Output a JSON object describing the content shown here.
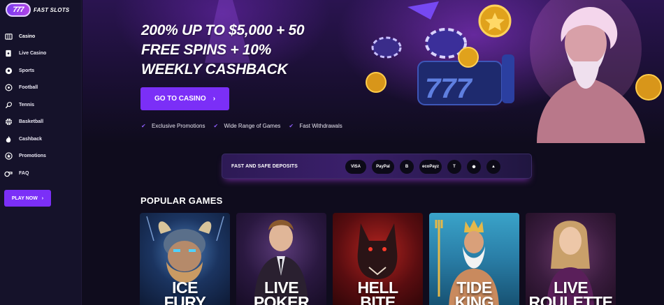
{
  "brand": {
    "badge": "777",
    "name": "FAST SLOTS"
  },
  "sidebar": {
    "items": [
      {
        "label": "Casino",
        "icon": "casino-icon"
      },
      {
        "label": "Live Casino",
        "icon": "live-casino-icon"
      },
      {
        "label": "Sports",
        "icon": "soccer-ball-icon"
      },
      {
        "label": "Football",
        "icon": "football-icon"
      },
      {
        "label": "Tennis",
        "icon": "tennis-icon"
      },
      {
        "label": "Basketball",
        "icon": "basketball-icon"
      },
      {
        "label": "Cashback",
        "icon": "flame-icon"
      },
      {
        "label": "Promotions",
        "icon": "gift-icon"
      },
      {
        "label": "FAQ",
        "icon": "whistle-icon"
      }
    ],
    "play_label": "PLAY NOW"
  },
  "hero": {
    "title_line1": "200% UP TO $5,000 + 50",
    "title_line2": "FREE SPINS + 10%",
    "title_line3": "WEEKLY CASHBACK",
    "cta_label": "GO TO CASINO",
    "features": [
      "Exclusive Promotions",
      "Wide Range of Games",
      "Fast Withdrawals"
    ]
  },
  "deposits": {
    "label": "FAST AND SAFE DEPOSITS",
    "methods": [
      "VISA",
      "PayPal",
      "B",
      "ecoPayz",
      "T",
      "✺",
      "▲"
    ]
  },
  "popular": {
    "title": "POPULAR GAMES",
    "games": [
      {
        "line1": "ICE",
        "line2": "FURY"
      },
      {
        "line1": "LIVE",
        "line2": "POKER"
      },
      {
        "line1": "HELL",
        "line2": "BITE"
      },
      {
        "line1": "TIDE",
        "line2": "KING"
      },
      {
        "line1": "LIVE",
        "line2": "ROULETTE"
      }
    ]
  },
  "colors": {
    "accent": "#7b2ff7",
    "background": "#0f0c1d",
    "sidebar": "#15122a"
  }
}
